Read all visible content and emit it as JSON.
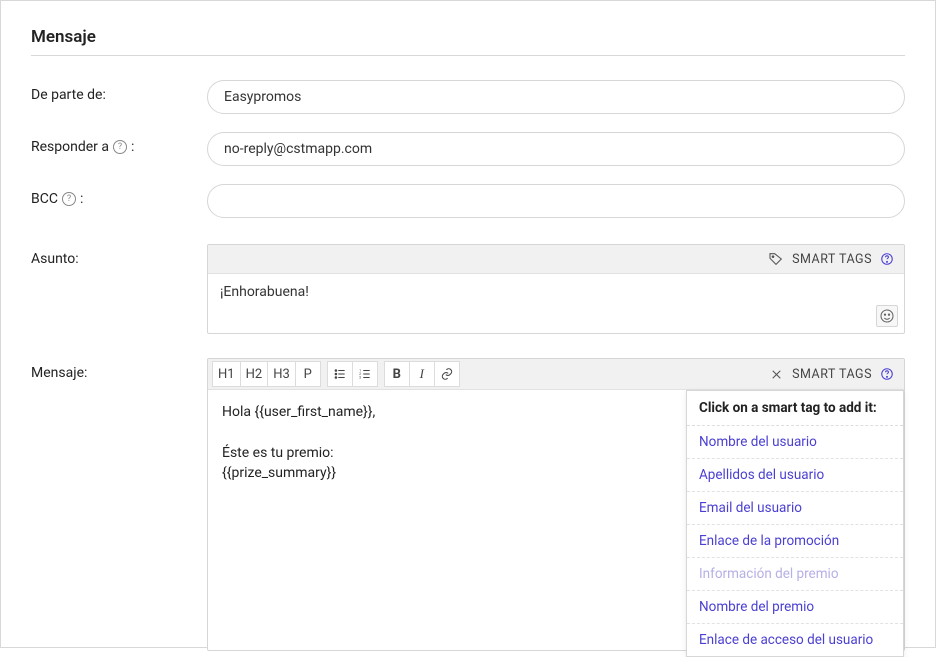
{
  "section_title": "Mensaje",
  "rows": {
    "from_label": "De parte de:",
    "from_value": "Easypromos",
    "reply_label": "Responder a",
    "reply_value": "no-reply@cstmapp.com",
    "bcc_label": "BCC",
    "bcc_value": "",
    "subject_label": "Asunto:",
    "message_label": "Mensaje:"
  },
  "smarttags_label": "SMART TAGS",
  "subject_value": "¡Enhorabuena!",
  "editor_body": "Hola {{user_first_name}},\n\nÉste es tu premio:\n{{prize_summary}}",
  "toolbar": {
    "h1": "H1",
    "h2": "H2",
    "h3": "H3",
    "p": "P",
    "bold": "B",
    "italic": "I"
  },
  "smart_panel": {
    "header": "Click on a smart tag to add it:",
    "items": [
      "Nombre del usuario",
      "Apellidos del usuario",
      "Email del usuario",
      "Enlace de la promoción",
      "Información del premio",
      "Nombre del premio",
      "Enlace de acceso del usuario"
    ],
    "hovered_index": 4
  }
}
